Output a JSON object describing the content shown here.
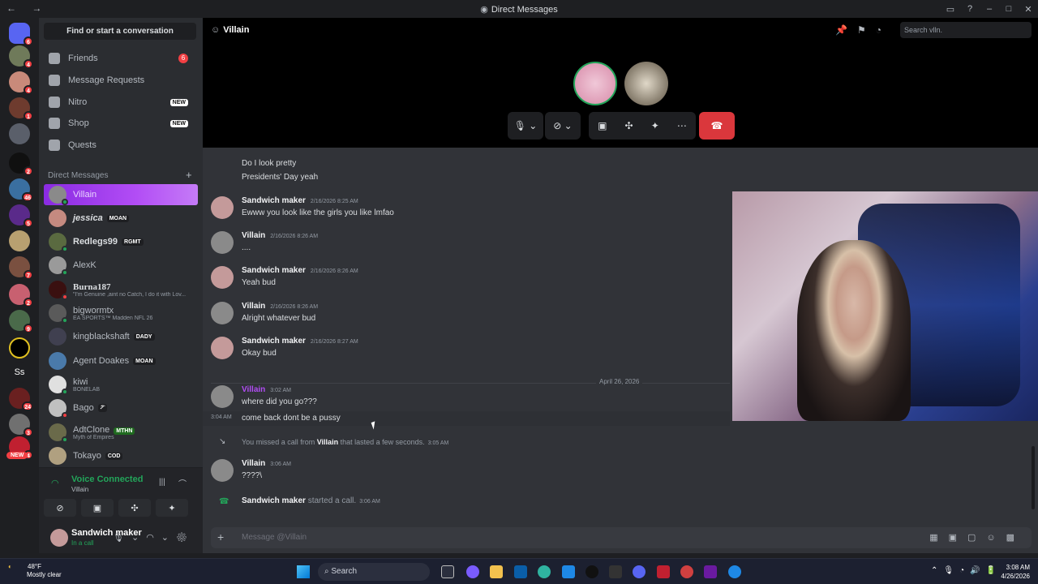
{
  "window": {
    "title": "Direct Messages",
    "nav": "← →"
  },
  "sidebar": {
    "search_label": "Find or start a conversation",
    "nav_items": [
      {
        "label": "Friends",
        "badge": "6"
      },
      {
        "label": "Message Requests"
      },
      {
        "label": "Nitro",
        "badge": "NEW"
      },
      {
        "label": "Shop",
        "badge": "NEW"
      },
      {
        "label": "Quests"
      }
    ],
    "dm_header": "Direct Messages",
    "dms": [
      {
        "name": "Villain",
        "active": true
      },
      {
        "name": "jessica",
        "tag": "MOAN"
      },
      {
        "name": "Redlegs99",
        "tag": "RGMT"
      },
      {
        "name": "AlexK"
      },
      {
        "name": "Burna187",
        "sub": "\"I'm Genuine ,aint no Catch, I do it with Lov..."
      },
      {
        "name": "bigwormtx",
        "sub": "EA SPORTS™ Madden NFL 26"
      },
      {
        "name": "kingblackshaft",
        "tag": "DADY"
      },
      {
        "name": "Agent Doakes",
        "tag": "MOAN"
      },
      {
        "name": "kiwi",
        "sub": "BONELAB"
      },
      {
        "name": "Bago",
        "tag": "ፖ"
      },
      {
        "name": "AdtClone",
        "tag": "MTHN",
        "sub": "Myth of Empires"
      },
      {
        "name": "Tokayo",
        "tag": "COD"
      }
    ],
    "guild_badges": [
      "6",
      "4",
      "4",
      "1",
      "",
      "2",
      "46",
      "5",
      "",
      "7",
      "2",
      "9",
      "",
      "",
      "24",
      "3",
      "4",
      "NEW"
    ]
  },
  "voice": {
    "title": "Voice Connected",
    "channel": "Villain"
  },
  "user": {
    "name": "Sandwich maker",
    "status": "In a call"
  },
  "channel": {
    "name": "Villain",
    "search_placeholder": "Search vlln."
  },
  "messages": [
    {
      "text1": "Do I look pretty",
      "text2": "Presidents' Day yeah"
    },
    {
      "author": "Sandwich maker",
      "ts": "2/16/2026 8:25 AM",
      "text": "Ewww you look like the girls you like lmfao"
    },
    {
      "author": "Villain",
      "ts": "2/16/2026 8:26 AM",
      "text": "...."
    },
    {
      "author": "Sandwich maker",
      "ts": "2/16/2026 8:26 AM",
      "text": "Yeah bud"
    },
    {
      "author": "Villain",
      "ts": "2/16/2026 8:26 AM",
      "text": "Alright whatever bud"
    },
    {
      "author": "Sandwich maker",
      "ts": "2/16/2026 8:27 AM",
      "text": "Okay bud"
    },
    {
      "author": "Villain",
      "ts": "3:02 AM",
      "text": "where did you go???"
    },
    {
      "ts": "3:04 AM",
      "text": "come back dont be a pussy"
    },
    {
      "system1": "You missed a call from ",
      "system_name": "Villain",
      "system2": " that lasted a few seconds.",
      "ts": "3:05 AM"
    },
    {
      "author": "Villain",
      "ts": "3:06 AM",
      "text": "????\\"
    },
    {
      "author": "Sandwich maker",
      "system": " started a call.",
      "ts": "3:06 AM"
    }
  ],
  "date_divider": "April 26, 2026",
  "composer": {
    "placeholder": "Message @Villain"
  },
  "taskbar": {
    "temp": "48°F",
    "weather": "Mostly clear",
    "search": "Search",
    "time": "3:08 AM",
    "date": "4/26/2026"
  },
  "colors": {
    "accent": "#b24df5",
    "voice_green": "#23a55a",
    "hangup": "#da373c"
  }
}
